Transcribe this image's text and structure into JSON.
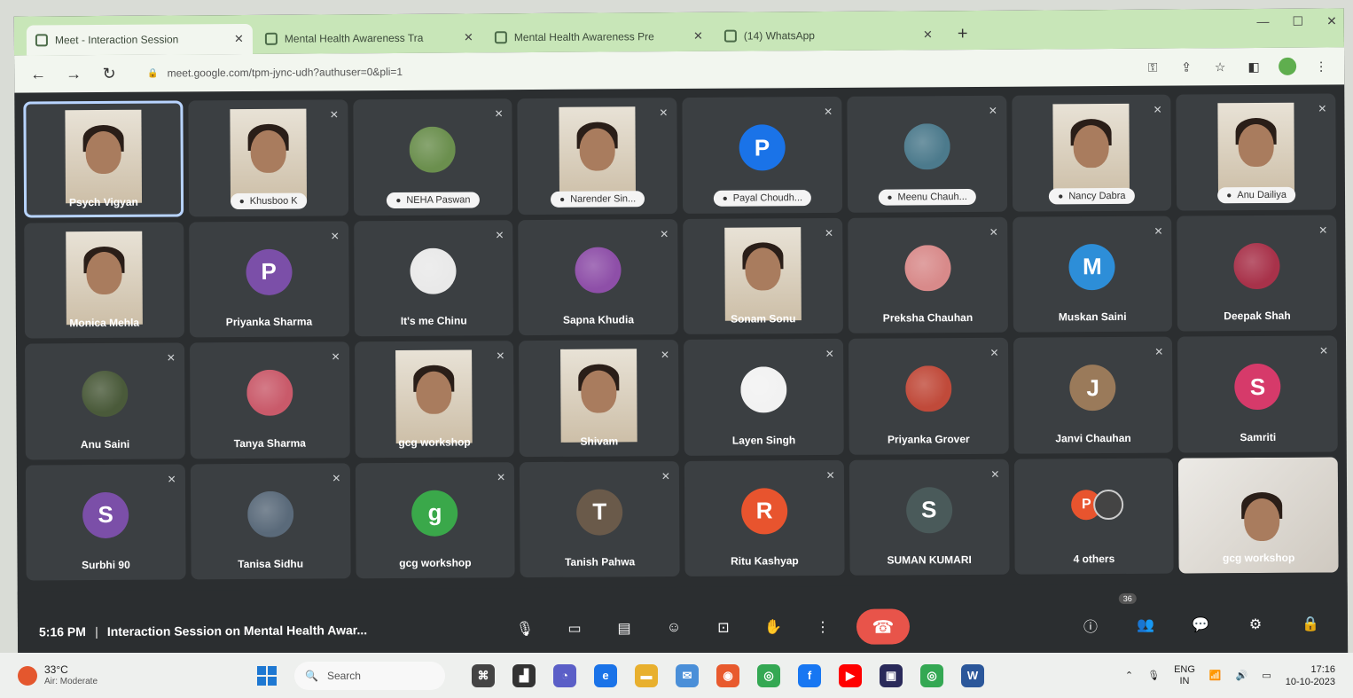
{
  "browser": {
    "tabs": [
      {
        "label": "Meet - Interaction Session",
        "icon": "meet-icon",
        "active": true
      },
      {
        "label": "Mental Health Awareness Tra",
        "icon": "doc-icon",
        "active": false
      },
      {
        "label": "Mental Health Awareness Pre",
        "icon": "doc-icon",
        "active": false
      },
      {
        "label": "(14) WhatsApp",
        "icon": "whatsapp-icon",
        "active": false
      }
    ],
    "new_tab": "+",
    "url": "meet.google.com/tpm-jync-udh?authuser=0&pli=1"
  },
  "participants": [
    {
      "name": "Psych Vigyan",
      "type": "video",
      "selfview": true,
      "muted": false
    },
    {
      "name": "Khusboo K",
      "type": "video-pill",
      "muted": true
    },
    {
      "name": "NEHA Paswan",
      "type": "photo-pill",
      "color": "#6b8f4e",
      "muted": true
    },
    {
      "name": "Narender Sin...",
      "type": "video-pill",
      "muted": true
    },
    {
      "name": "Payal Choudh...",
      "type": "avatar-pill",
      "initial": "P",
      "color": "#1a73e8",
      "muted": true
    },
    {
      "name": "Meenu Chauh...",
      "type": "photo-pill",
      "color": "#4c7a8c",
      "muted": true
    },
    {
      "name": "Nancy Dabra",
      "type": "video-pill",
      "muted": true
    },
    {
      "name": "Anu Dailiya",
      "type": "video-pill",
      "muted": true
    },
    {
      "name": "Monica Mehla",
      "type": "video",
      "muted": false
    },
    {
      "name": "Priyanka Sharma",
      "type": "avatar",
      "initial": "P",
      "color": "#7b4fa8",
      "muted": true
    },
    {
      "name": "It's me Chinu",
      "type": "photo",
      "color": "#e9e9e9",
      "muted": true
    },
    {
      "name": "Sapna Khudia",
      "type": "photo",
      "color": "#8e4fa8",
      "muted": true
    },
    {
      "name": "Sonam Sonu",
      "type": "video",
      "muted": true
    },
    {
      "name": "Preksha Chauhan",
      "type": "photo",
      "color": "#d88a8a",
      "muted": true
    },
    {
      "name": "Muskan Saini",
      "type": "avatar",
      "initial": "M",
      "color": "#2d8ed8",
      "muted": true
    },
    {
      "name": "Deepak Shah",
      "type": "photo",
      "color": "#a8324a",
      "muted": true
    },
    {
      "name": "Anu Saini",
      "type": "photo",
      "color": "#4a5a3a",
      "muted": true
    },
    {
      "name": "Tanya Sharma",
      "type": "photo",
      "color": "#c95a6a",
      "muted": true
    },
    {
      "name": "gcg workshop",
      "type": "video",
      "muted": true
    },
    {
      "name": "Shivam",
      "type": "video",
      "muted": true
    },
    {
      "name": "Layen Singh",
      "type": "photo",
      "color": "#f2f2f2",
      "muted": true
    },
    {
      "name": "Priyanka Grover",
      "type": "photo",
      "color": "#c04a3a",
      "muted": true
    },
    {
      "name": "Janvi Chauhan",
      "type": "avatar",
      "initial": "J",
      "color": "#9a7a5a",
      "muted": true
    },
    {
      "name": "Samriti",
      "type": "avatar",
      "initial": "S",
      "color": "#d63a6a",
      "muted": true
    },
    {
      "name": "Surbhi 90",
      "type": "avatar",
      "initial": "S",
      "color": "#7b4fa8",
      "muted": true
    },
    {
      "name": "Tanisa Sidhu",
      "type": "photo",
      "color": "#5a6a7a",
      "muted": true
    },
    {
      "name": "gcg workshop",
      "type": "avatar",
      "initial": "g",
      "color": "#3aa84a",
      "muted": true
    },
    {
      "name": "Tanish Pahwa",
      "type": "avatar",
      "initial": "T",
      "color": "#6a5a4a",
      "muted": true
    },
    {
      "name": "Ritu Kashyap",
      "type": "avatar",
      "initial": "R",
      "color": "#e8542e",
      "muted": true
    },
    {
      "name": "SUMAN KUMARI",
      "type": "avatar",
      "initial": "S",
      "color": "#4a5a5a",
      "muted": true
    },
    {
      "name": "4 others",
      "type": "others",
      "initial": "P",
      "color": "#e8542e",
      "muted": false
    },
    {
      "name": "gcg workshop",
      "type": "presenting",
      "muted": false
    }
  ],
  "meeting": {
    "time": "5:16 PM",
    "separator": "|",
    "title": "Interaction Session on Mental Health Awar...",
    "participant_count": "36",
    "end_call_color": "#e8544a"
  },
  "taskbar": {
    "temperature": "33°C",
    "air_quality": "Air: Moderate",
    "search_placeholder": "Search",
    "lang_top": "ENG",
    "lang_bottom": "IN",
    "time": "17:16",
    "date": "10-10-2023"
  }
}
